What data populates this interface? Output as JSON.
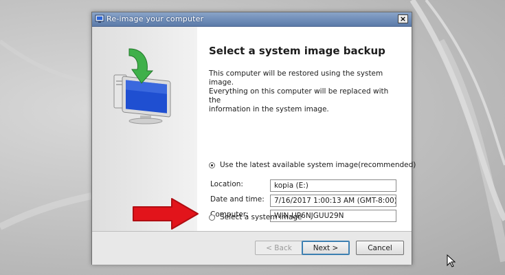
{
  "window": {
    "title": "Re-image your computer",
    "close_glyph": "×"
  },
  "page": {
    "heading": "Select a system image backup",
    "description_line1": "This computer will be restored using the system image.",
    "description_line2": "Everything on this computer will be replaced with the",
    "description_line3": "information in the system image."
  },
  "options": {
    "latest_label": "Use the latest available system image(recommended)",
    "latest_selected": true,
    "select_label": "Select a system image",
    "select_selected": false
  },
  "details": {
    "location_label": "Location:",
    "location_value": "kopia (E:)",
    "datetime_label": "Date and time:",
    "datetime_value": "7/16/2017 1:00:13 AM (GMT-8:00)",
    "computer_label": "Computer:",
    "computer_value": "WIN-UP6NJGUU29N"
  },
  "buttons": {
    "back": "< Back",
    "next": "Next >",
    "cancel": "Cancel"
  },
  "colors": {
    "titlebar": "#6f8db8",
    "arrow_red": "#e2141b",
    "monitor_blue": "#1f4fd1",
    "arrow_green": "#3fb04a"
  },
  "icons": {
    "title": "backup-restore-icon",
    "art": "monitor-restore-icon",
    "pointer": "mouse-cursor-icon",
    "annotation": "red-arrow-icon"
  }
}
